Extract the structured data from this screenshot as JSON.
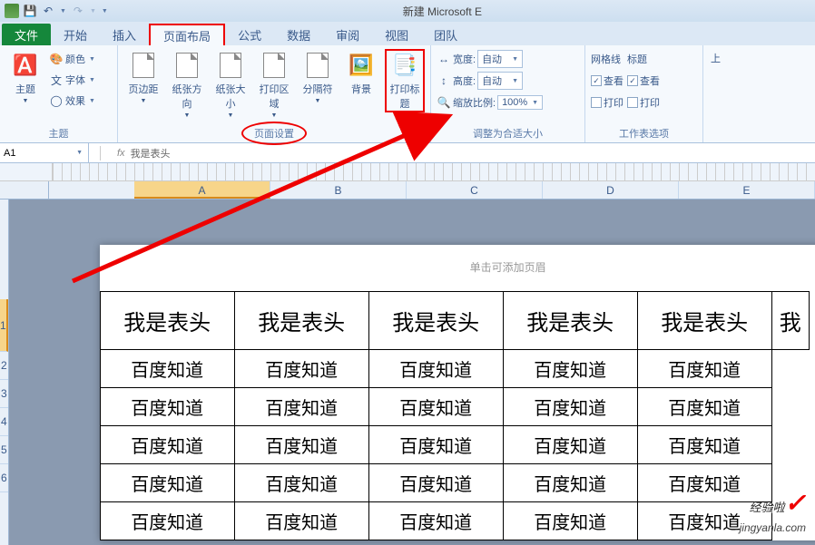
{
  "title": "新建 Microsoft E",
  "tabs": {
    "file": "文件",
    "items": [
      "开始",
      "插入",
      "页面布局",
      "公式",
      "数据",
      "审阅",
      "视图",
      "团队"
    ],
    "active_index": 2
  },
  "ribbon": {
    "theme": {
      "label": "主题",
      "main": "主题",
      "colors": "颜色",
      "fonts": "字体",
      "effects": "效果"
    },
    "page_setup": {
      "label": "页面设置",
      "margins": "页边距",
      "orientation": "纸张方向",
      "size": "纸张大小",
      "print_area": "打印区域",
      "breaks": "分隔符",
      "background": "背景",
      "print_titles": "打印标题"
    },
    "scale": {
      "label": "调整为合适大小",
      "width": "宽度:",
      "height": "高度:",
      "scale_label": "缩放比例:",
      "auto": "自动",
      "scale_value": "100%"
    },
    "sheet_options": {
      "label": "工作表选项",
      "gridlines": "网格线",
      "headings": "标题",
      "view": "查看",
      "print": "打印"
    },
    "arrange_btn": "上"
  },
  "formula_bar": {
    "name_box": "A1",
    "fx": "fx",
    "content": "我是表头"
  },
  "columns": [
    "A",
    "B",
    "C",
    "D",
    "E"
  ],
  "selected_col": 0,
  "rows": [
    1,
    2,
    3,
    4,
    5,
    6
  ],
  "selected_row": 0,
  "page_header_hint": "单击可添加页眉",
  "chart_data": {
    "type": "table",
    "header_row": [
      "我是表头",
      "我是表头",
      "我是表头",
      "我是表头",
      "我是表头",
      "我"
    ],
    "body_rows": [
      [
        "百度知道",
        "百度知道",
        "百度知道",
        "百度知道",
        "百度知道"
      ],
      [
        "百度知道",
        "百度知道",
        "百度知道",
        "百度知道",
        "百度知道"
      ],
      [
        "百度知道",
        "百度知道",
        "百度知道",
        "百度知道",
        "百度知道"
      ],
      [
        "百度知道",
        "百度知道",
        "百度知道",
        "百度知道",
        "百度知道"
      ],
      [
        "百度知道",
        "百度知道",
        "百度知道",
        "百度知道",
        "百度知道"
      ]
    ]
  },
  "watermark": {
    "brand": "经验啦",
    "url": "jingyanla.com"
  }
}
